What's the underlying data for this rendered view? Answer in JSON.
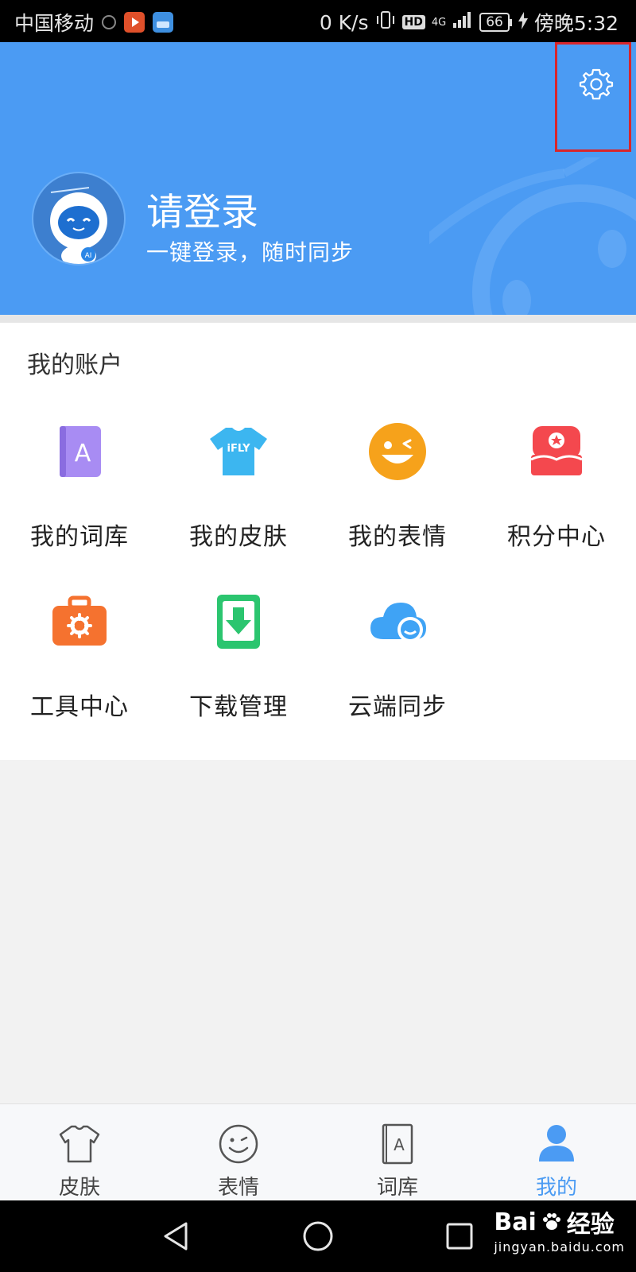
{
  "status_bar": {
    "carrier": "中国移动",
    "speed": "0 K/s",
    "hd": "HD",
    "network": "4G",
    "battery": "66",
    "time": "傍晚5:32"
  },
  "header": {
    "login_title": "请登录",
    "login_subtitle": "一键登录，随时同步",
    "avatar_badge": "AI"
  },
  "account": {
    "section_title": "我的账户",
    "items": [
      {
        "label": "我的词库",
        "icon": "dictionary-icon",
        "color": "#9b7ff0"
      },
      {
        "label": "我的皮肤",
        "icon": "skin-shirt-icon",
        "color": "#3cb6f0",
        "text": "iFLY"
      },
      {
        "label": "我的表情",
        "icon": "emoji-icon",
        "color": "#f6a21b"
      },
      {
        "label": "积分中心",
        "icon": "points-shop-icon",
        "color": "#f4484e"
      },
      {
        "label": "工具中心",
        "icon": "toolbox-icon",
        "color": "#f5722f"
      },
      {
        "label": "下载管理",
        "icon": "download-icon",
        "color": "#2bc56f"
      },
      {
        "label": "云端同步",
        "icon": "cloud-sync-icon",
        "color": "#3fa3f5"
      }
    ]
  },
  "tabs": [
    {
      "label": "皮肤",
      "icon": "shirt-icon",
      "active": false
    },
    {
      "label": "表情",
      "icon": "smiley-icon",
      "active": false
    },
    {
      "label": "词库",
      "icon": "book-icon",
      "active": false,
      "text": "A"
    },
    {
      "label": "我的",
      "icon": "person-icon",
      "active": true
    }
  ],
  "colors": {
    "accent": "#4b9bf3",
    "highlight": "#d8262b"
  },
  "watermark": {
    "brand": "Bai",
    "brand2": "经验",
    "url": "jingyan.baidu.com"
  }
}
